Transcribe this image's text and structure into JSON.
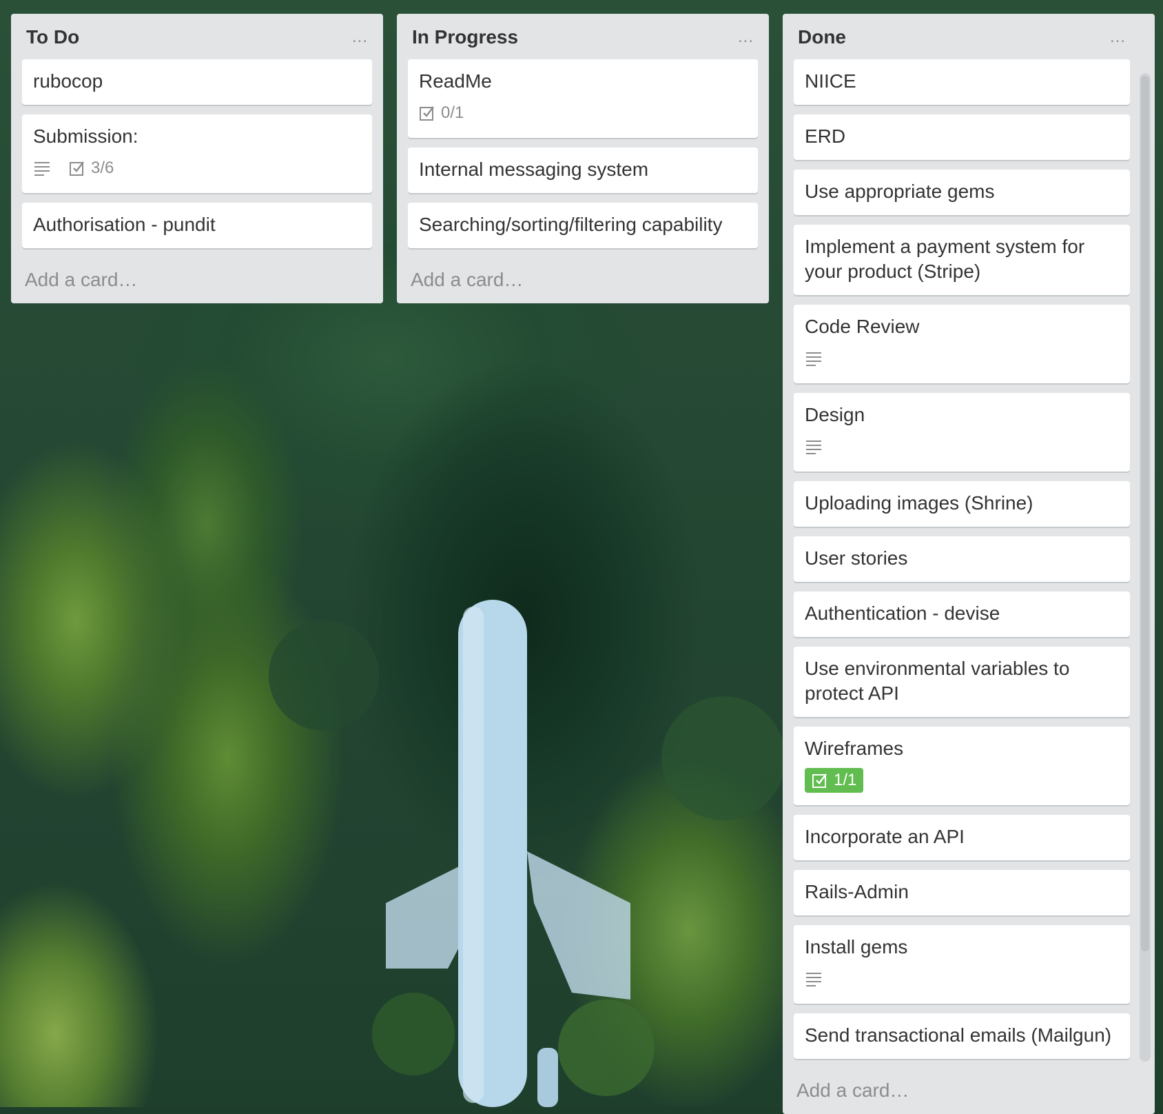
{
  "lists": [
    {
      "title": "To Do",
      "menu_label": "...",
      "add_card_label": "Add a card…",
      "cards": [
        {
          "title": "rubocop"
        },
        {
          "title": "Submission:",
          "description_icon": "description-icon",
          "checklist": "3/6"
        },
        {
          "title": "Authorisation - pundit"
        }
      ]
    },
    {
      "title": "In Progress",
      "menu_label": "...",
      "add_card_label": "Add a card…",
      "cards": [
        {
          "title": "ReadMe",
          "checklist": "0/1"
        },
        {
          "title": "Internal messaging system"
        },
        {
          "title": "Searching/sorting/filtering capability"
        }
      ]
    },
    {
      "title": "Done",
      "menu_label": "...",
      "add_card_label": "Add a card…",
      "cards": [
        {
          "title": "NIICE"
        },
        {
          "title": "ERD"
        },
        {
          "title": "Use appropriate gems"
        },
        {
          "title": "Implement a payment system for your product (Stripe)"
        },
        {
          "title": "Code Review",
          "description_icon": "description-icon"
        },
        {
          "title": "Design",
          "description_icon": "description-icon"
        },
        {
          "title": "Uploading images (Shrine)"
        },
        {
          "title": "User stories"
        },
        {
          "title": "Authentication - devise"
        },
        {
          "title": "Use environmental variables to protect API"
        },
        {
          "title": "Wireframes",
          "checklist": "1/1",
          "checklist_complete": true
        },
        {
          "title": "Incorporate an API"
        },
        {
          "title": "Rails-Admin"
        },
        {
          "title": "Install gems",
          "description_icon": "description-icon"
        },
        {
          "title": "Send transactional emails (Mailgun)"
        }
      ]
    }
  ],
  "colors": {
    "list_bg": "#e2e4e6",
    "card_bg": "#ffffff",
    "checklist_complete": "#61bd4f",
    "muted_text": "#8c8c8c"
  }
}
